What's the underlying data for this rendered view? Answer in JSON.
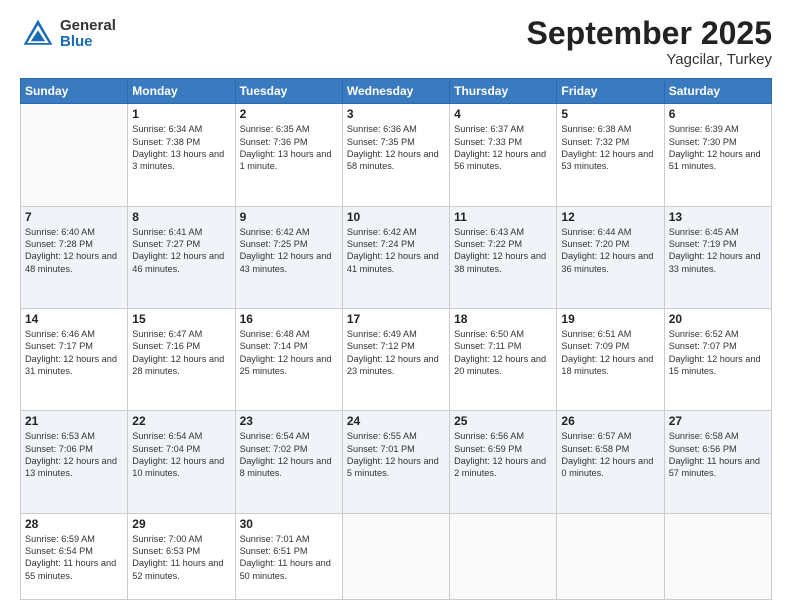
{
  "header": {
    "logo": {
      "general": "General",
      "blue": "Blue"
    },
    "month": "September 2025",
    "location": "Yagcilar, Turkey"
  },
  "weekdays": [
    "Sunday",
    "Monday",
    "Tuesday",
    "Wednesday",
    "Thursday",
    "Friday",
    "Saturday"
  ],
  "weeks": [
    [
      {
        "day": "",
        "sunrise": "",
        "sunset": "",
        "daylight": ""
      },
      {
        "day": "1",
        "sunrise": "Sunrise: 6:34 AM",
        "sunset": "Sunset: 7:38 PM",
        "daylight": "Daylight: 13 hours and 3 minutes."
      },
      {
        "day": "2",
        "sunrise": "Sunrise: 6:35 AM",
        "sunset": "Sunset: 7:36 PM",
        "daylight": "Daylight: 13 hours and 1 minute."
      },
      {
        "day": "3",
        "sunrise": "Sunrise: 6:36 AM",
        "sunset": "Sunset: 7:35 PM",
        "daylight": "Daylight: 12 hours and 58 minutes."
      },
      {
        "day": "4",
        "sunrise": "Sunrise: 6:37 AM",
        "sunset": "Sunset: 7:33 PM",
        "daylight": "Daylight: 12 hours and 56 minutes."
      },
      {
        "day": "5",
        "sunrise": "Sunrise: 6:38 AM",
        "sunset": "Sunset: 7:32 PM",
        "daylight": "Daylight: 12 hours and 53 minutes."
      },
      {
        "day": "6",
        "sunrise": "Sunrise: 6:39 AM",
        "sunset": "Sunset: 7:30 PM",
        "daylight": "Daylight: 12 hours and 51 minutes."
      }
    ],
    [
      {
        "day": "7",
        "sunrise": "Sunrise: 6:40 AM",
        "sunset": "Sunset: 7:28 PM",
        "daylight": "Daylight: 12 hours and 48 minutes."
      },
      {
        "day": "8",
        "sunrise": "Sunrise: 6:41 AM",
        "sunset": "Sunset: 7:27 PM",
        "daylight": "Daylight: 12 hours and 46 minutes."
      },
      {
        "day": "9",
        "sunrise": "Sunrise: 6:42 AM",
        "sunset": "Sunset: 7:25 PM",
        "daylight": "Daylight: 12 hours and 43 minutes."
      },
      {
        "day": "10",
        "sunrise": "Sunrise: 6:42 AM",
        "sunset": "Sunset: 7:24 PM",
        "daylight": "Daylight: 12 hours and 41 minutes."
      },
      {
        "day": "11",
        "sunrise": "Sunrise: 6:43 AM",
        "sunset": "Sunset: 7:22 PM",
        "daylight": "Daylight: 12 hours and 38 minutes."
      },
      {
        "day": "12",
        "sunrise": "Sunrise: 6:44 AM",
        "sunset": "Sunset: 7:20 PM",
        "daylight": "Daylight: 12 hours and 36 minutes."
      },
      {
        "day": "13",
        "sunrise": "Sunrise: 6:45 AM",
        "sunset": "Sunset: 7:19 PM",
        "daylight": "Daylight: 12 hours and 33 minutes."
      }
    ],
    [
      {
        "day": "14",
        "sunrise": "Sunrise: 6:46 AM",
        "sunset": "Sunset: 7:17 PM",
        "daylight": "Daylight: 12 hours and 31 minutes."
      },
      {
        "day": "15",
        "sunrise": "Sunrise: 6:47 AM",
        "sunset": "Sunset: 7:16 PM",
        "daylight": "Daylight: 12 hours and 28 minutes."
      },
      {
        "day": "16",
        "sunrise": "Sunrise: 6:48 AM",
        "sunset": "Sunset: 7:14 PM",
        "daylight": "Daylight: 12 hours and 25 minutes."
      },
      {
        "day": "17",
        "sunrise": "Sunrise: 6:49 AM",
        "sunset": "Sunset: 7:12 PM",
        "daylight": "Daylight: 12 hours and 23 minutes."
      },
      {
        "day": "18",
        "sunrise": "Sunrise: 6:50 AM",
        "sunset": "Sunset: 7:11 PM",
        "daylight": "Daylight: 12 hours and 20 minutes."
      },
      {
        "day": "19",
        "sunrise": "Sunrise: 6:51 AM",
        "sunset": "Sunset: 7:09 PM",
        "daylight": "Daylight: 12 hours and 18 minutes."
      },
      {
        "day": "20",
        "sunrise": "Sunrise: 6:52 AM",
        "sunset": "Sunset: 7:07 PM",
        "daylight": "Daylight: 12 hours and 15 minutes."
      }
    ],
    [
      {
        "day": "21",
        "sunrise": "Sunrise: 6:53 AM",
        "sunset": "Sunset: 7:06 PM",
        "daylight": "Daylight: 12 hours and 13 minutes."
      },
      {
        "day": "22",
        "sunrise": "Sunrise: 6:54 AM",
        "sunset": "Sunset: 7:04 PM",
        "daylight": "Daylight: 12 hours and 10 minutes."
      },
      {
        "day": "23",
        "sunrise": "Sunrise: 6:54 AM",
        "sunset": "Sunset: 7:02 PM",
        "daylight": "Daylight: 12 hours and 8 minutes."
      },
      {
        "day": "24",
        "sunrise": "Sunrise: 6:55 AM",
        "sunset": "Sunset: 7:01 PM",
        "daylight": "Daylight: 12 hours and 5 minutes."
      },
      {
        "day": "25",
        "sunrise": "Sunrise: 6:56 AM",
        "sunset": "Sunset: 6:59 PM",
        "daylight": "Daylight: 12 hours and 2 minutes."
      },
      {
        "day": "26",
        "sunrise": "Sunrise: 6:57 AM",
        "sunset": "Sunset: 6:58 PM",
        "daylight": "Daylight: 12 hours and 0 minutes."
      },
      {
        "day": "27",
        "sunrise": "Sunrise: 6:58 AM",
        "sunset": "Sunset: 6:56 PM",
        "daylight": "Daylight: 11 hours and 57 minutes."
      }
    ],
    [
      {
        "day": "28",
        "sunrise": "Sunrise: 6:59 AM",
        "sunset": "Sunset: 6:54 PM",
        "daylight": "Daylight: 11 hours and 55 minutes."
      },
      {
        "day": "29",
        "sunrise": "Sunrise: 7:00 AM",
        "sunset": "Sunset: 6:53 PM",
        "daylight": "Daylight: 11 hours and 52 minutes."
      },
      {
        "day": "30",
        "sunrise": "Sunrise: 7:01 AM",
        "sunset": "Sunset: 6:51 PM",
        "daylight": "Daylight: 11 hours and 50 minutes."
      },
      {
        "day": "",
        "sunrise": "",
        "sunset": "",
        "daylight": ""
      },
      {
        "day": "",
        "sunrise": "",
        "sunset": "",
        "daylight": ""
      },
      {
        "day": "",
        "sunrise": "",
        "sunset": "",
        "daylight": ""
      },
      {
        "day": "",
        "sunrise": "",
        "sunset": "",
        "daylight": ""
      }
    ]
  ]
}
